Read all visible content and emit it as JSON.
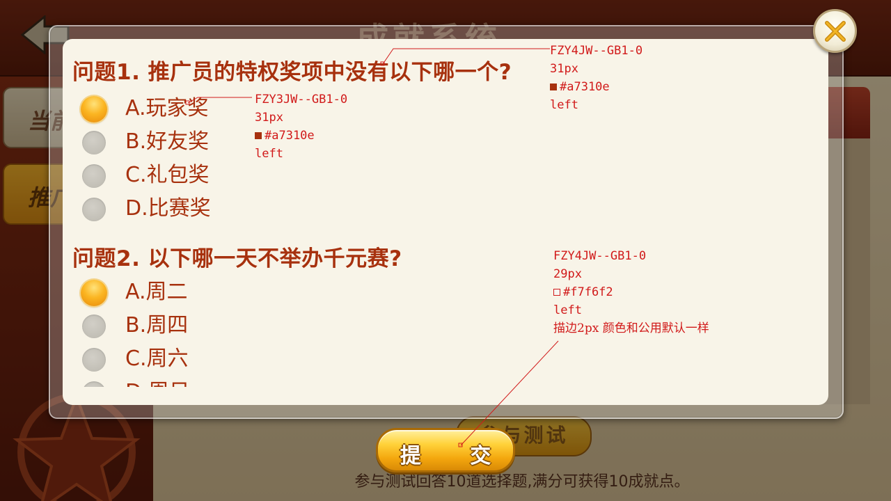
{
  "background": {
    "window_title": "成就系统",
    "tabs": [
      "当前",
      "推广"
    ],
    "join_button_label": "参与测试",
    "hint_text": "参与测试回答10道选择题,满分可获得10成就点。"
  },
  "quiz": {
    "questions": [
      {
        "title": "问题1. 推广员的特权奖项中没有以下哪一个?",
        "options": [
          "A.玩家奖",
          "B.好友奖",
          "C.礼包奖",
          "D.比赛奖"
        ],
        "selected_index": 0
      },
      {
        "title": "问题2. 以下哪一天不举办千元赛?",
        "options": [
          "A.周二",
          "B.周四",
          "C.周六",
          "D.周日"
        ],
        "selected_index": 0
      }
    ]
  },
  "submit_button_label": "提  交",
  "annotations": {
    "title_spec": {
      "font": "FZY4JW--GB1-0",
      "size": "31px",
      "color": "#a7310e",
      "align": "left"
    },
    "option_spec": {
      "font": "FZY3JW--GB1-0",
      "size": "31px",
      "color": "#a7310e",
      "align": "left"
    },
    "button_spec": {
      "font": "FZY4JW--GB1-0",
      "size": "29px",
      "color": "#f7f6f2",
      "align": "left",
      "note": "描边2px  颜色和公用默认一样"
    }
  },
  "colors": {
    "text_primary": "#a7310e",
    "button_text": "#f7f6f2",
    "panel_bg": "#f8f4e8",
    "annotation": "#d11a1a"
  },
  "icons": [
    "back-arrow-icon",
    "close-icon",
    "radio-checked-icon",
    "radio-unchecked-icon"
  ]
}
